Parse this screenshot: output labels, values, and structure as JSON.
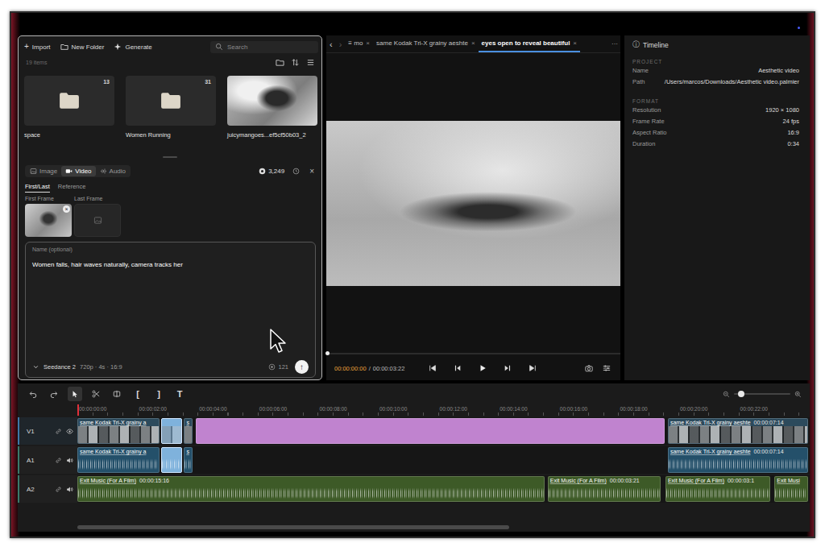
{
  "media_browser": {
    "toolbar": [
      {
        "kind": "glyph",
        "glyph": "+",
        "label": "Import"
      },
      {
        "kind": "folder",
        "label": "New Folder"
      },
      {
        "kind": "generate",
        "label": "Generate"
      }
    ],
    "search": {
      "placeholder": "Search"
    },
    "count": "19 items",
    "items": [
      {
        "kind": "folder",
        "label": "space",
        "count": "13"
      },
      {
        "kind": "folder",
        "label": "Women Running",
        "count": "31"
      },
      {
        "kind": "image",
        "label": "juicymangoes...ef5cf50b03_2",
        "count": ""
      }
    ]
  },
  "generator": {
    "tabs": [
      {
        "kind": "image",
        "label": "Image",
        "selected": false
      },
      {
        "kind": "video",
        "label": "Video",
        "selected": true
      },
      {
        "kind": "audio",
        "label": "Audio",
        "selected": false
      }
    ],
    "credits": "3,249",
    "close": "×",
    "modes": [
      {
        "label": "First/Last",
        "selected": true
      },
      {
        "label": "Reference",
        "selected": false
      }
    ],
    "frames": [
      {
        "label": "First Frame",
        "filled": true,
        "remove": "×"
      },
      {
        "label": "Last Frame",
        "filled": false,
        "remove": ""
      }
    ],
    "name_placeholder": "Name (optional)",
    "prompt": "Women falls, hair waves naturally, camera tracks her",
    "model": "Seedance 2",
    "settings": "720p · 4s · 16:9",
    "cost": "121",
    "send": "↑"
  },
  "viewer": {
    "nav": [
      {
        "glyph": "‹",
        "disabled": false
      },
      {
        "glyph": "›",
        "disabled": true
      }
    ],
    "tabs": [
      {
        "label": "≡ mo",
        "selected": false,
        "close": "×"
      },
      {
        "label": "same Kodak Tri-X grainy aeshte",
        "selected": false,
        "close": "×"
      },
      {
        "label": "eyes open to reveal beautiful",
        "selected": true,
        "close": "×"
      }
    ],
    "more": "···",
    "current_time": "00:00:00:00",
    "separator": "/",
    "total_time": "00:00:03:22",
    "progress": 0
  },
  "inspector": {
    "icon": "ⓘ",
    "title": "Timeline",
    "sections": [
      {
        "heading": "PROJECT",
        "rows": [
          {
            "label": "Name",
            "value": "Aesthetic video"
          },
          {
            "label": "Path",
            "value": "/Users/marcos/Downloads/Aesthetic video.palmier"
          }
        ]
      },
      {
        "heading": "FORMAT",
        "rows": [
          {
            "label": "Resolution",
            "value": "1920 × 1080"
          },
          {
            "label": "Frame Rate",
            "value": "24 fps"
          },
          {
            "label": "Aspect Ratio",
            "value": "16:9"
          },
          {
            "label": "Duration",
            "value": "0:34"
          }
        ]
      }
    ]
  },
  "timeline": {
    "tools": [
      {
        "kind": "undo",
        "glyph": "",
        "selected": false
      },
      {
        "kind": "redo",
        "glyph": "",
        "selected": false
      },
      {
        "kind": "select",
        "glyph": "",
        "selected": true
      },
      {
        "kind": "cut",
        "glyph": "",
        "selected": false
      },
      {
        "kind": "split",
        "glyph": "",
        "selected": false
      },
      {
        "kind": "glyph",
        "glyph": "[",
        "selected": false
      },
      {
        "kind": "glyph",
        "glyph": "]",
        "selected": false
      },
      {
        "kind": "glyph",
        "glyph": "T",
        "selected": false
      }
    ],
    "zoom": 0.1,
    "ruler": [
      "00:00:00:00",
      "00:00:02:00",
      "00:00:04:00",
      "00:00:06:00",
      "00:00:08:00",
      "00:00:10:00",
      "00:00:12:00",
      "00:00:14:00",
      "00:00:16:00",
      "00:00:18:00",
      "00:00:20:00",
      "00:00:22:00"
    ],
    "playhead_seconds": 0,
    "scroll": {
      "level": 0.59
    },
    "tracks": [
      {
        "name": "V1",
        "kind": "video",
        "clips": [
          {
            "label": "same Kodak Tri-X grainy a",
            "duration": "",
            "start": 0,
            "end": 2.8,
            "kind": "video",
            "color": "#2c4a5c",
            "selected": false
          },
          {
            "label": "",
            "duration": "",
            "start": 2.8,
            "end": 3.55,
            "kind": "video",
            "color": "#7fb2dc",
            "selected": true
          },
          {
            "label": "s",
            "duration": "",
            "start": 3.55,
            "end": 3.9,
            "kind": "video",
            "color": "#2c4a5c",
            "selected": false
          },
          {
            "label": "",
            "duration": "",
            "start": 3.95,
            "end": 19.6,
            "kind": "solid",
            "color": "#c083cf",
            "selected": false
          },
          {
            "label": "same Kodak Tri-X grainy aeshte",
            "duration": "00:00:07:14",
            "start": 19.65,
            "end": 24.37,
            "kind": "video",
            "color": "#2c4a5c",
            "selected": false
          }
        ]
      },
      {
        "name": "A1",
        "kind": "audio",
        "clips": [
          {
            "label": "same Kodak Tri-X grainy a",
            "duration": "",
            "start": 0,
            "end": 2.8,
            "kind": "audio",
            "color": "#24506a",
            "selected": false
          },
          {
            "label": "",
            "duration": "",
            "start": 2.8,
            "end": 3.55,
            "kind": "audio",
            "color": "#7fb2dc",
            "selected": true
          },
          {
            "label": "s",
            "duration": "",
            "start": 3.55,
            "end": 3.9,
            "kind": "audio",
            "color": "#24506a",
            "selected": false
          },
          {
            "label": "same Kodak Tri-X grainy aeshte",
            "duration": "00:00:07:14",
            "start": 19.65,
            "end": 24.37,
            "kind": "audio",
            "color": "#24506a",
            "selected": false
          }
        ]
      },
      {
        "name": "A2",
        "kind": "audio",
        "clips": [
          {
            "label": "Exit Music (For A Film)",
            "duration": "00:00:15:16",
            "start": 0,
            "end": 15.6,
            "kind": "audio",
            "color": "#3d5a27",
            "selected": false
          },
          {
            "label": "Exit Music (For A Film)",
            "duration": "00:00:03:21",
            "start": 15.65,
            "end": 19.47,
            "kind": "audio",
            "color": "#3d5a27",
            "selected": false
          },
          {
            "label": "Exit Music (For A Film)",
            "duration": "00:00:03:1",
            "start": 19.57,
            "end": 23.1,
            "kind": "audio",
            "color": "#3d5a27",
            "selected": false
          },
          {
            "label": "Exit Musi",
            "duration": "",
            "start": 23.2,
            "end": 24.37,
            "kind": "audio",
            "color": "#3d5a27",
            "selected": false
          }
        ]
      }
    ]
  }
}
